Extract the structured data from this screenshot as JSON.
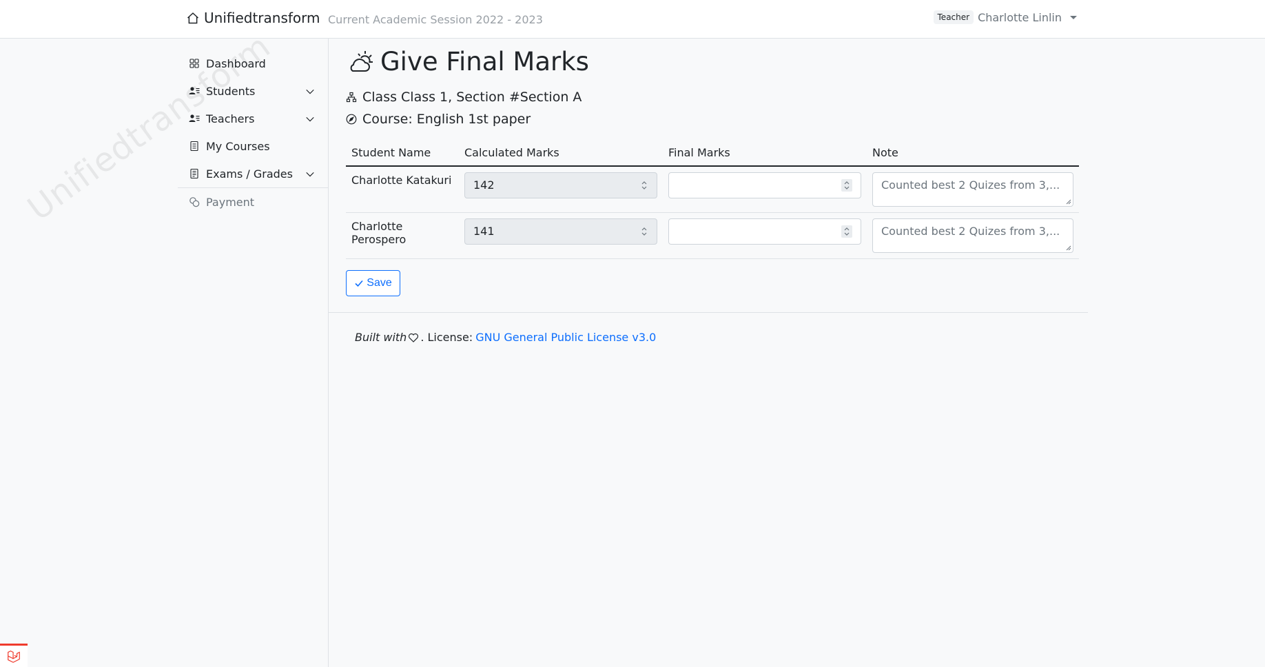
{
  "navbar": {
    "brand": "Unifiedtransform",
    "session": "Current Academic Session 2022 - 2023",
    "role_badge": "Teacher",
    "user_name": "Charlotte Linlin"
  },
  "watermark": "Unifiedtransform",
  "sidebar": {
    "items": [
      {
        "label": "Dashboard",
        "icon": "grid-icon",
        "has_chevron": false
      },
      {
        "label": "Students",
        "icon": "person-lines-icon",
        "has_chevron": true
      },
      {
        "label": "Teachers",
        "icon": "person-lines-icon",
        "has_chevron": true
      },
      {
        "label": "My Courses",
        "icon": "journal-icon",
        "has_chevron": false
      },
      {
        "label": "Exams / Grades",
        "icon": "file-text-icon",
        "has_chevron": true
      },
      {
        "label": "Payment",
        "icon": "coins-icon",
        "has_chevron": false
      }
    ]
  },
  "page": {
    "title": "Give Final Marks",
    "class_line": "Class Class 1, Section #Section A",
    "course_line": "Course: English 1st paper"
  },
  "table": {
    "headers": [
      "Student Name",
      "Calculated Marks",
      "Final Marks",
      "Note"
    ],
    "rows": [
      {
        "student": "Charlotte Katakuri",
        "calculated": "142",
        "final": "",
        "note": "Counted best 2 Quizes from 3,..."
      },
      {
        "student": "Charlotte Perospero",
        "calculated": "141",
        "final": "",
        "note": "Counted best 2 Quizes from 3,..."
      }
    ]
  },
  "actions": {
    "save_label": "Save"
  },
  "footer": {
    "built_with": "Built with",
    "license_prefix": ". License:",
    "license_link": "GNU General Public License v3.0"
  },
  "colors": {
    "primary": "#0d6efd",
    "laravel_red": "#ef3b2d"
  }
}
